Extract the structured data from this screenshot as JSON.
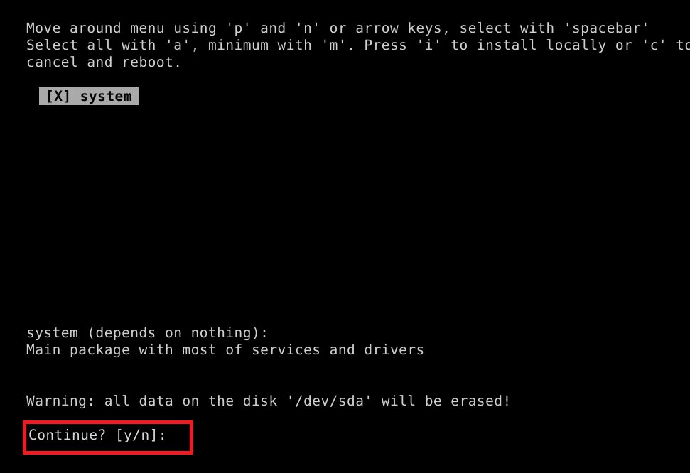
{
  "screen": {
    "background_color": "#000000",
    "foreground_color": "#cfcfcf",
    "highlight_background_color": "#aaaaaa",
    "highlight_foreground_color": "#000000",
    "annotation_color": "#ef1b22"
  },
  "instructions": {
    "line1": "Move around menu using 'p' and 'n' or arrow keys, select with 'spacebar'",
    "line2": "Select all with 'a', minimum with 'm'. Press 'i' to install locally or 'c' to",
    "line3": "cancel and reboot."
  },
  "menu": {
    "items": [
      {
        "label": "[X] system",
        "checkbox": "[X]",
        "name": "system",
        "selected": true,
        "checked": true
      }
    ]
  },
  "description": {
    "title": "system (depends on nothing):",
    "body": "Main package with most of services and drivers"
  },
  "warning": {
    "text": "Warning: all data on the disk '/dev/sda' will be erased!",
    "device": "/dev/sda"
  },
  "prompt": {
    "text": "Continue? [y/n]:",
    "question": "Continue?",
    "options": "[y/n]",
    "value": ""
  }
}
